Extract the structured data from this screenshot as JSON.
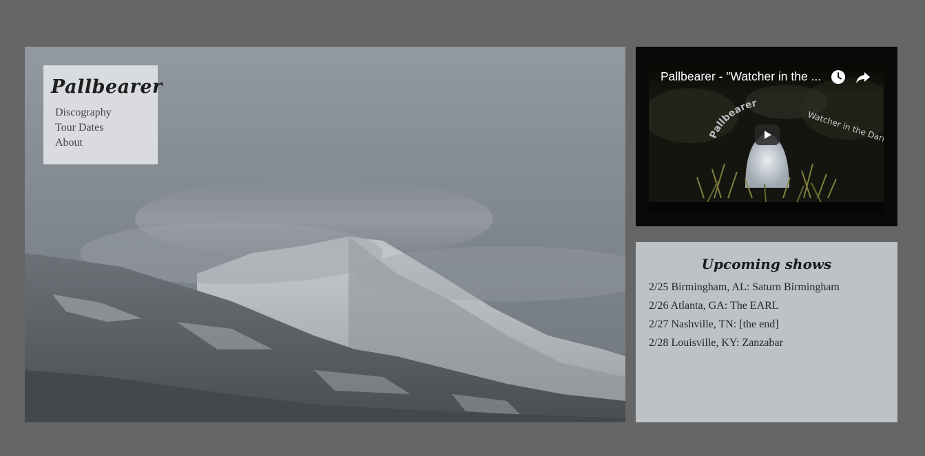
{
  "site": {
    "title": "Pallbearer"
  },
  "nav": {
    "items": [
      {
        "label": "Discography"
      },
      {
        "label": "Tour Dates"
      },
      {
        "label": "About"
      }
    ]
  },
  "video": {
    "title": "Pallbearer - \"Watcher in the ...",
    "thumb_band": "Pallbearer",
    "thumb_song": "Watcher in the Dark",
    "icons": [
      "watch-later-icon",
      "share-icon",
      "play-icon"
    ]
  },
  "shows": {
    "heading": "Upcoming shows",
    "items": [
      {
        "text": "2/25 Birmingham, AL: Saturn Birmingham"
      },
      {
        "text": "2/26 Atlanta, GA: The EARL"
      },
      {
        "text": "2/27 Nashville, TN: [the end]"
      },
      {
        "text": "2/28 Louisville, KY: Zanzabar"
      }
    ]
  },
  "colors": {
    "page_background": "#666666",
    "nav_box": "#dfe1e4",
    "video_panel": "#0a0908",
    "shows_panel": "#bcc2c5"
  }
}
